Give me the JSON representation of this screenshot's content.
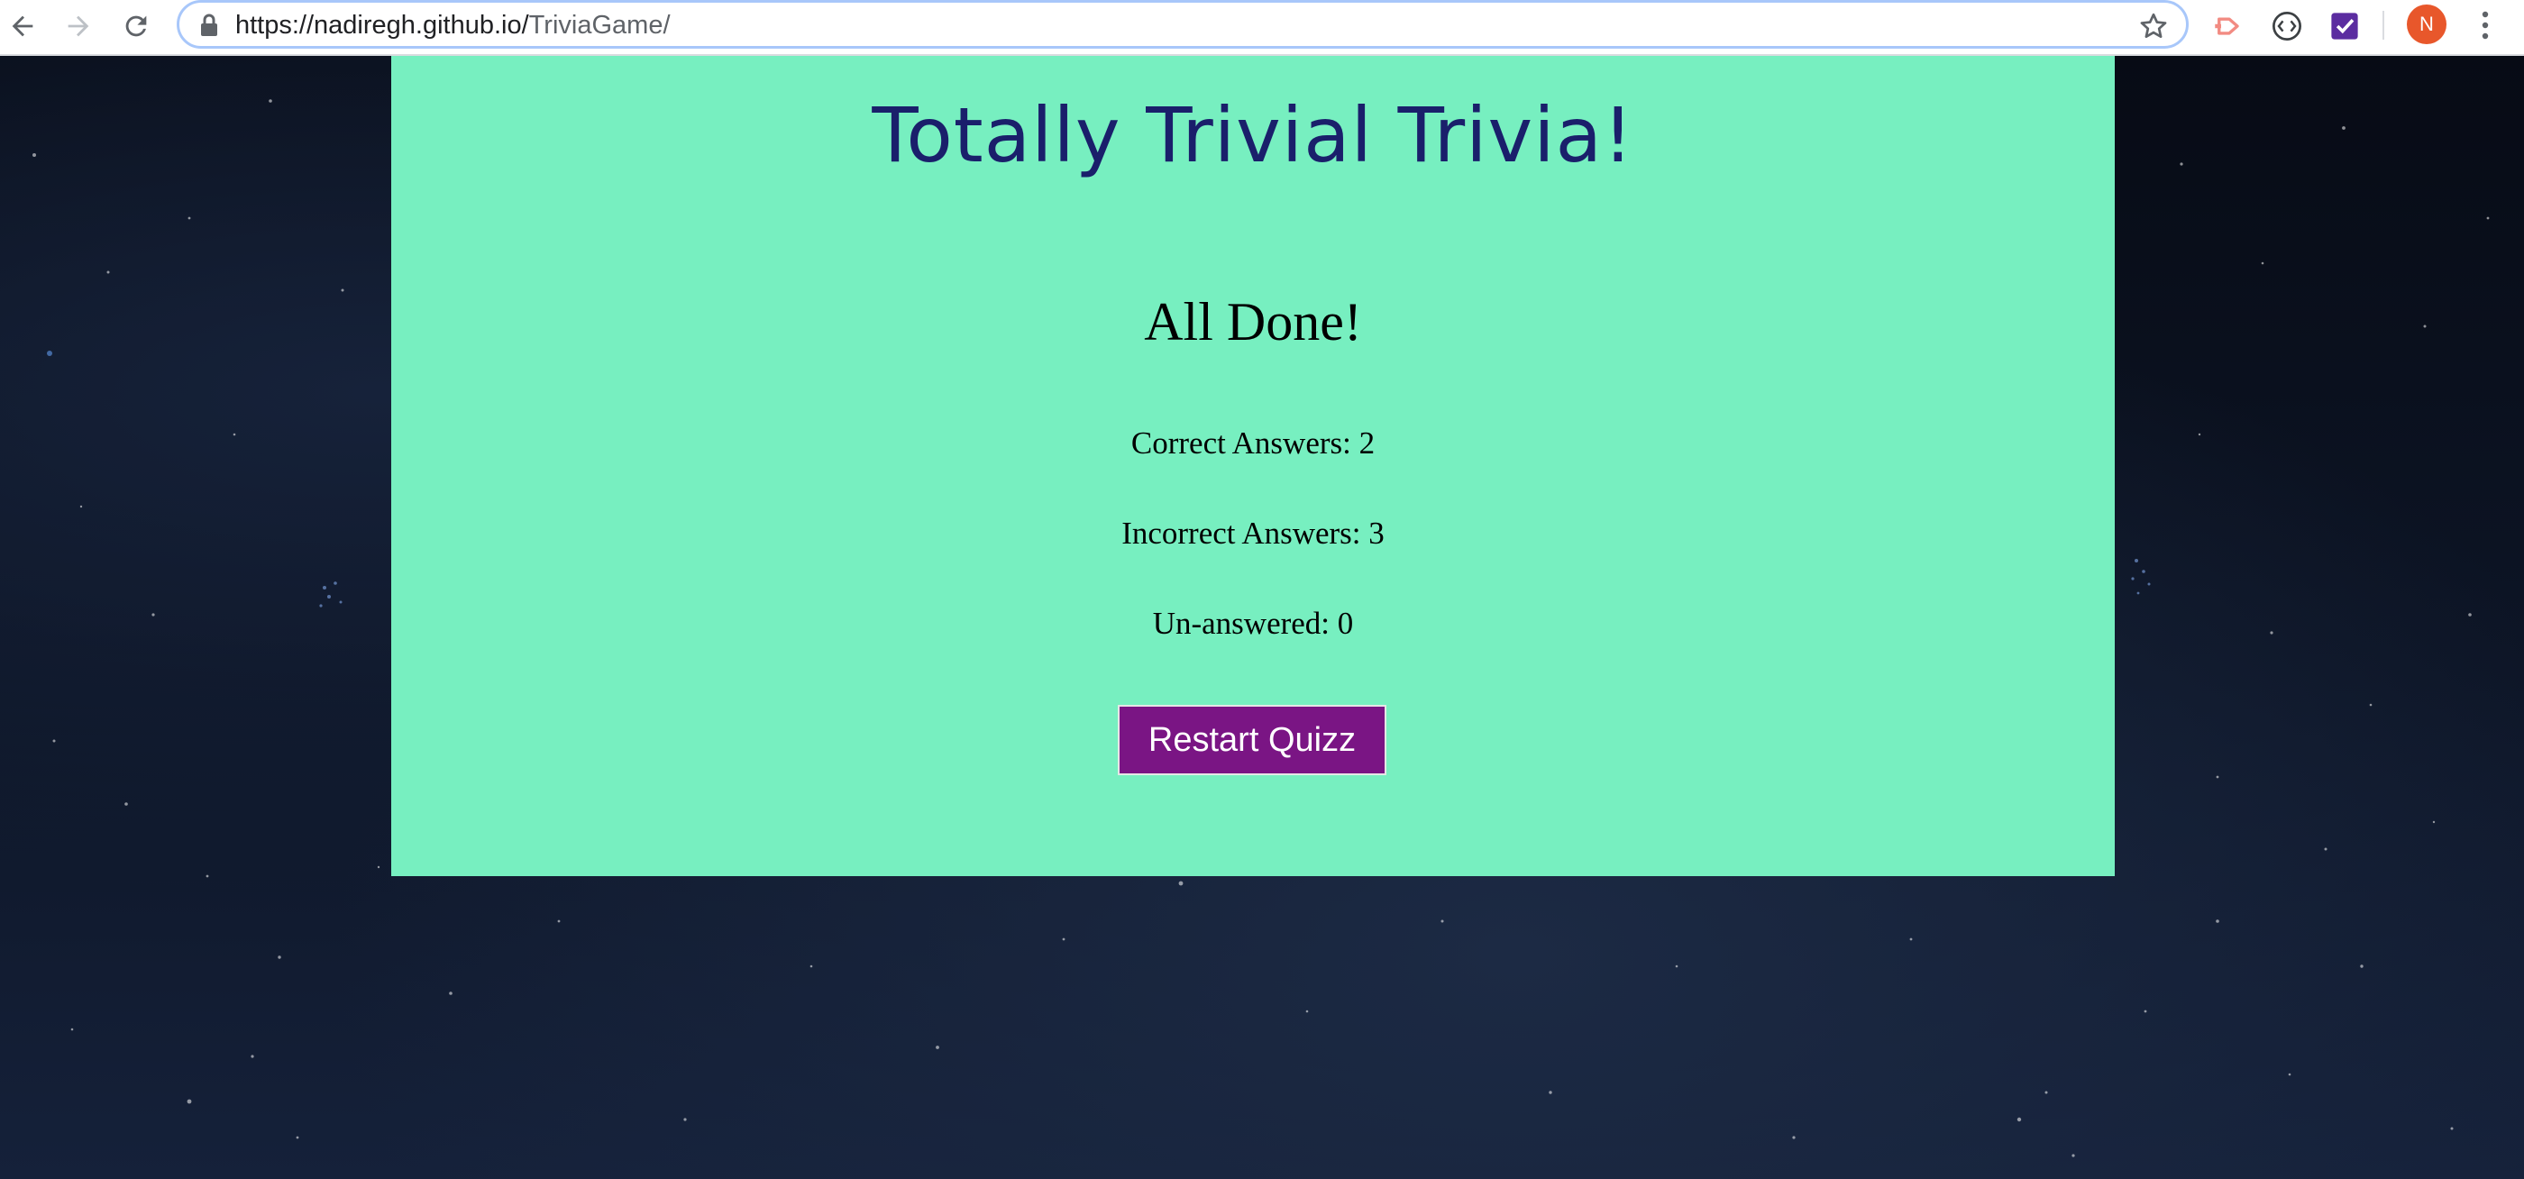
{
  "browser": {
    "url_host": "https://nadiregh.github.io/",
    "url_path": "TriviaGame/",
    "profile_initial": "N",
    "icons": {
      "back": "arrow-left-icon",
      "forward": "arrow-right-icon",
      "reload": "reload-icon",
      "lock": "lock-icon",
      "bookmark": "star-icon",
      "extension_1": "cast-icon",
      "extension_2": "code-icon",
      "extension_3": "checkbox-icon",
      "menu": "kebab-menu-icon"
    },
    "colors": {
      "omnibox_border": "#a8c7fa",
      "avatar": "#e8572b",
      "extension_3": "#5b2ca0"
    }
  },
  "game": {
    "title": "Totally Trivial Trivia!",
    "results_heading": "All Done!",
    "correct_label": "Correct Answers: 2",
    "incorrect_label": "Incorrect Answers: 3",
    "unanswered_label": "Un-answered: 0",
    "restart_label": "Restart Quizz",
    "colors": {
      "card_background": "#77efc0",
      "title": "#1a1f6b",
      "button": "#7a1584",
      "page_background": "#0b1120"
    }
  }
}
